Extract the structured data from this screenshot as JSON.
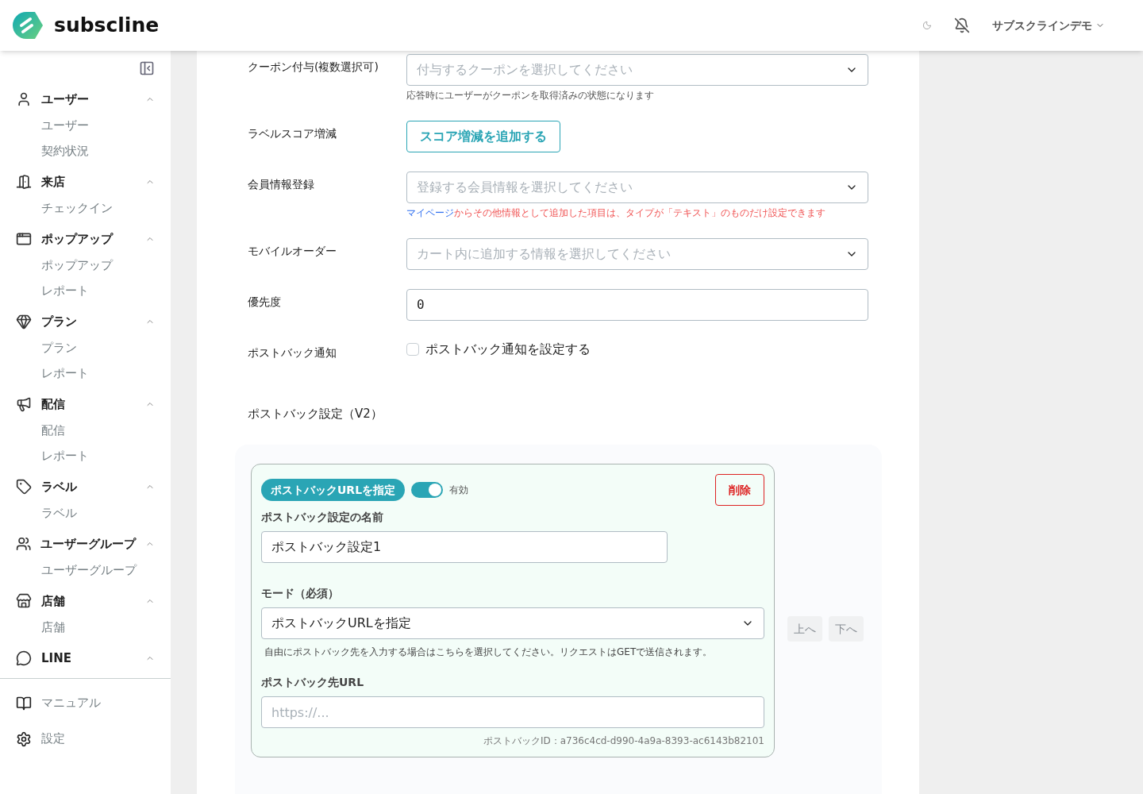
{
  "header": {
    "logo_text": "subscline",
    "account": "サブスクラインデモ"
  },
  "sidebar": {
    "groups": [
      {
        "label": "ユーザー",
        "expanded": true,
        "items": [
          "ユーザー",
          "契約状況"
        ]
      },
      {
        "label": "来店",
        "expanded": true,
        "items": [
          "チェックイン"
        ]
      },
      {
        "label": "ポップアップ",
        "expanded": true,
        "items": [
          "ポップアップ",
          "レポート"
        ]
      },
      {
        "label": "プラン",
        "expanded": true,
        "items": [
          "プラン",
          "レポート"
        ]
      },
      {
        "label": "配信",
        "expanded": true,
        "items": [
          "配信",
          "レポート"
        ]
      },
      {
        "label": "ラベル",
        "expanded": true,
        "items": [
          "ラベル"
        ]
      },
      {
        "label": "ユーザーグループ",
        "expanded": true,
        "items": [
          "ユーザーグループ"
        ]
      },
      {
        "label": "店舗",
        "expanded": true,
        "items": [
          "店舗"
        ]
      },
      {
        "label": "LINE",
        "expanded": true
      }
    ],
    "footer": [
      "マニュアル",
      "設定"
    ]
  },
  "form": {
    "rows": [
      {
        "kind": "select",
        "label": "クーポン付与(複数選択可)",
        "placeholder": "付与するクーポンを選択してください",
        "help": "応答時にユーザーがクーポンを取得済みの状態になります"
      },
      {
        "kind": "button",
        "label": "ラベルスコア増減",
        "button": "スコア増減を追加する"
      },
      {
        "kind": "select",
        "label": "会員情報登録",
        "placeholder": "登録する会員情報を選択してください",
        "help_link": "マイページ",
        "help_warning": "からその他情報として追加した項目は、タイプが「テキスト」のものだけ設定できます"
      },
      {
        "kind": "select",
        "label": "モバイルオーダー",
        "placeholder": "カート内に追加する情報を選択してください"
      },
      {
        "kind": "input",
        "label": "優先度",
        "value": "0"
      },
      {
        "kind": "checkbox",
        "label": "ポストバック通知",
        "text": "ポストバック通知を設定する",
        "checked": false
      }
    ],
    "section_title": "ポストバック設定（V2）"
  },
  "postback": {
    "badge": "ポストバックURLを指定",
    "enabled": {
      "on": true,
      "label": "有効"
    },
    "delete": "削除",
    "name_label": "ポストバック設定の名前",
    "name_value": "ポストバック設定1",
    "mode_label": "モード（必須）",
    "mode_value": "ポストバックURLを指定",
    "mode_help": "自由にポストバック先を入力する場合はこちらを選択してください。リクエストはGETで送信されます。",
    "url_label": "ポストバック先URL",
    "url_placeholder": "https://...",
    "id_text": "ポストバックID：a736c4cd-d990-4a9a-8393-ac6143b82101",
    "move_buttons": [
      {
        "label": "上へ",
        "disabled": true
      },
      {
        "label": "下へ",
        "disabled": true
      }
    ]
  }
}
